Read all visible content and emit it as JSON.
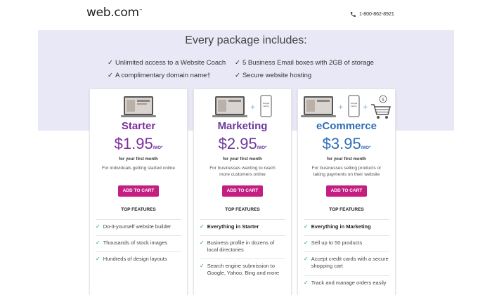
{
  "header": {
    "logo": "web.com",
    "logo_mark": "™",
    "phone": "1-800-862-8921",
    "phone_icon": "phone-icon"
  },
  "includes": {
    "title": "Every package includes:",
    "items": [
      "Unlimited access to a Website Coach",
      "5 Business Email boxes with 2GB of storage",
      "A complimentary domain name†",
      "Secure website hosting"
    ]
  },
  "plans": [
    {
      "name": "Starter",
      "price": "$1.95",
      "per": "/MO*",
      "first_month": "for your first month",
      "description": "For individuals getting started online",
      "cta": "ADD TO CART",
      "features_title": "TOP FEATURES",
      "features": [
        "Do-it-yourself website builder",
        "Thousands of stock images",
        "Hundreds of design layouts"
      ]
    },
    {
      "name": "Marketing",
      "price": "$2.95",
      "per": "/MO*",
      "first_month": "for your first month",
      "description": "For businesses wanting to reach more customers online",
      "cta": "ADD TO CART",
      "features_title": "TOP FEATURES",
      "features": [
        "Everything in Starter",
        "Business profile in dozens of local directories",
        "Search engine submission to Google, Yahoo, Bing and more"
      ],
      "art_label": "Google listing"
    },
    {
      "name": "eCommerce",
      "price": "$3.95",
      "per": "/MO*",
      "first_month": "for your first month",
      "description": "For businesses selling products or taking payments on their website",
      "cta": "ADD TO CART",
      "features_title": "TOP FEATURES",
      "features": [
        "Everything in Marketing",
        "Sell up to 50 products",
        "Accept credit cards with a secure shopping cart",
        "Track and manage orders easily"
      ],
      "art_label": "Google listing"
    }
  ],
  "colors": {
    "band": "#e8e8f7",
    "cta": "#c41e82",
    "check": "#2a9d5c",
    "starter": "#7d2f9e",
    "marketing": "#6a3a9a",
    "ecommerce": "#2e6fb5"
  }
}
